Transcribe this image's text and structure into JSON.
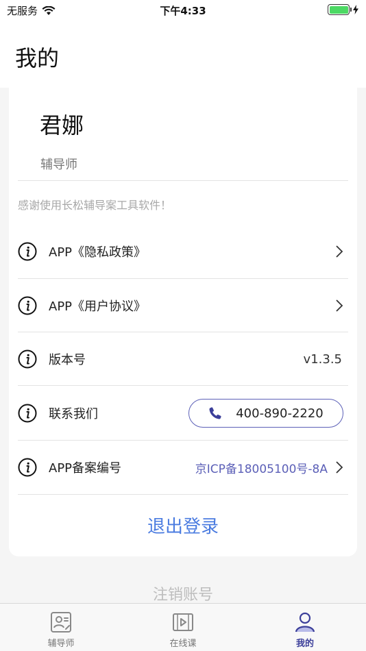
{
  "status_bar": {
    "carrier": "无服务",
    "time": "下午4:33",
    "wifi_icon": "wifi-icon",
    "battery_icon": "battery-icon",
    "charging_icon": "charging-bolt-icon"
  },
  "header": {
    "title": "我的"
  },
  "profile": {
    "name": "君娜",
    "role": "辅导师"
  },
  "welcome_text": "感谢使用长松辅导案工具软件！",
  "menu": {
    "privacy_label": "APP《隐私政策》",
    "agreement_label": "APP《用户协议》",
    "version_label": "版本号",
    "version_value": "v1.3.5",
    "contact_label": "联系我们",
    "phone_number": "400-890-2220",
    "record_label": "APP备案编号",
    "record_value": "京ICP备18005100号-8A"
  },
  "logout_label": "退出登录",
  "cancel_account_label": "注销账号",
  "tabs": [
    {
      "label": "辅导师",
      "icon": "tutor-icon",
      "active": false
    },
    {
      "label": "在线课",
      "icon": "video-play-icon",
      "active": false
    },
    {
      "label": "我的",
      "icon": "user-icon",
      "active": true
    }
  ],
  "colors": {
    "accent": "#5b5fb7",
    "link_blue": "#4a7be0",
    "tab_active": "#3c3f9a",
    "battery_green": "#4cd964"
  }
}
